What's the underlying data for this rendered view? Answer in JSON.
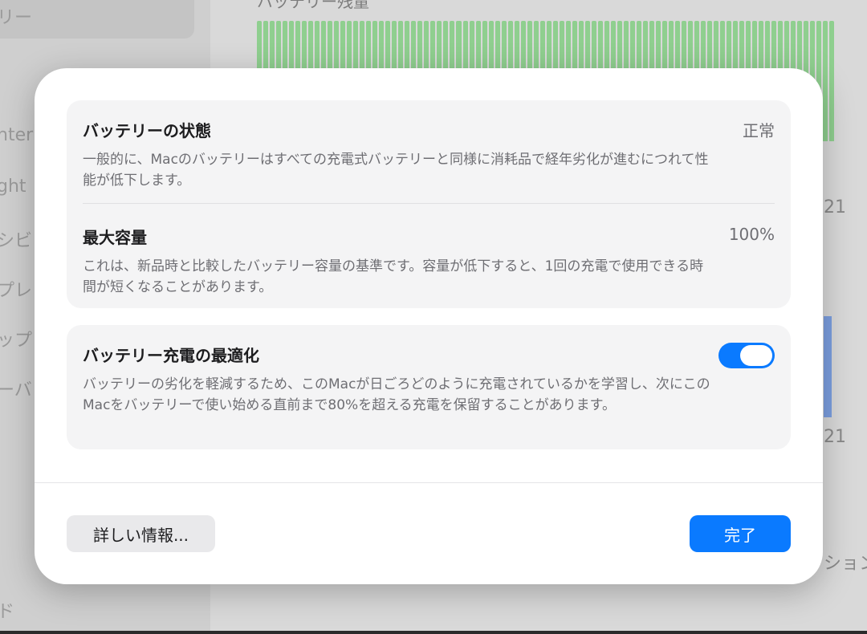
{
  "background": {
    "sidebar_labels": [
      "リー",
      "nter",
      "ght",
      "シビ",
      "プレ",
      "ップ",
      "ーバ",
      "ド"
    ],
    "chart_title": "バッテリー残量",
    "right_labels": [
      "21",
      "21",
      "ション"
    ]
  },
  "dialog": {
    "battery_health": {
      "title": "バッテリーの状態",
      "value": "正常",
      "description": "一般的に、Macのバッテリーはすべての充電式バッテリーと同様に消耗品で経年劣化が進むにつれて性能が低下します。"
    },
    "max_capacity": {
      "title": "最大容量",
      "value": "100%",
      "description": "これは、新品時と比較したバッテリー容量の基準です。容量が低下すると、1回の充電で使用できる時間が短くなることがあります。"
    },
    "optimized_charging": {
      "title": "バッテリー充電の最適化",
      "enabled": true,
      "description": "バッテリーの劣化を軽減するため、このMacが日ごろどのように充電されているかを学習し、次にこのMacをバッテリーで使い始める直前まで80%を超える充電を保留することがあります。"
    },
    "buttons": {
      "more_info": "詳しい情報...",
      "done": "完了"
    }
  },
  "colors": {
    "accent": "#0a7aff",
    "chart_bar": "#8fcf8f"
  }
}
